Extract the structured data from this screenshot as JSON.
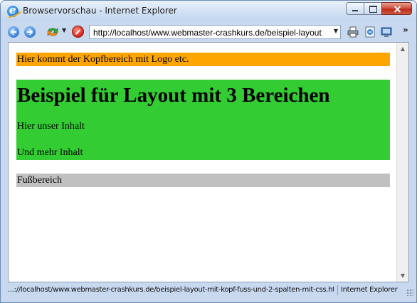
{
  "window": {
    "title": "Browservorschau - Internet Explorer"
  },
  "navigation": {
    "address": "http://localhost/www.webmaster-crashkurs.de/beispiel-layout",
    "icons": [
      "back-arrow-icon",
      "forward-arrow-icon",
      "refresh-icon",
      "stop-icon",
      "print-icon",
      "page-icon",
      "tools-icon"
    ]
  },
  "page": {
    "header_text": "Hier kommt der Kopfbereich mit Logo etc.",
    "content_title": "Beispiel für Layout mit 3 Bereichen",
    "content_paragraph_1": "Hier unser Inhalt",
    "content_paragraph_2": "Und mehr Inhalt",
    "footer_text": "Fußbereich",
    "colors": {
      "header": "#ffa500",
      "content": "#33cc33",
      "footer": "#c0c0c0"
    }
  },
  "statusbar": {
    "url": "...://localhost/www.webmaster-crashkurs.de/beispiel-layout-mit-kopf-fuss-und-2-spalten-mit-css.htm",
    "zone": "Internet Explorer"
  }
}
